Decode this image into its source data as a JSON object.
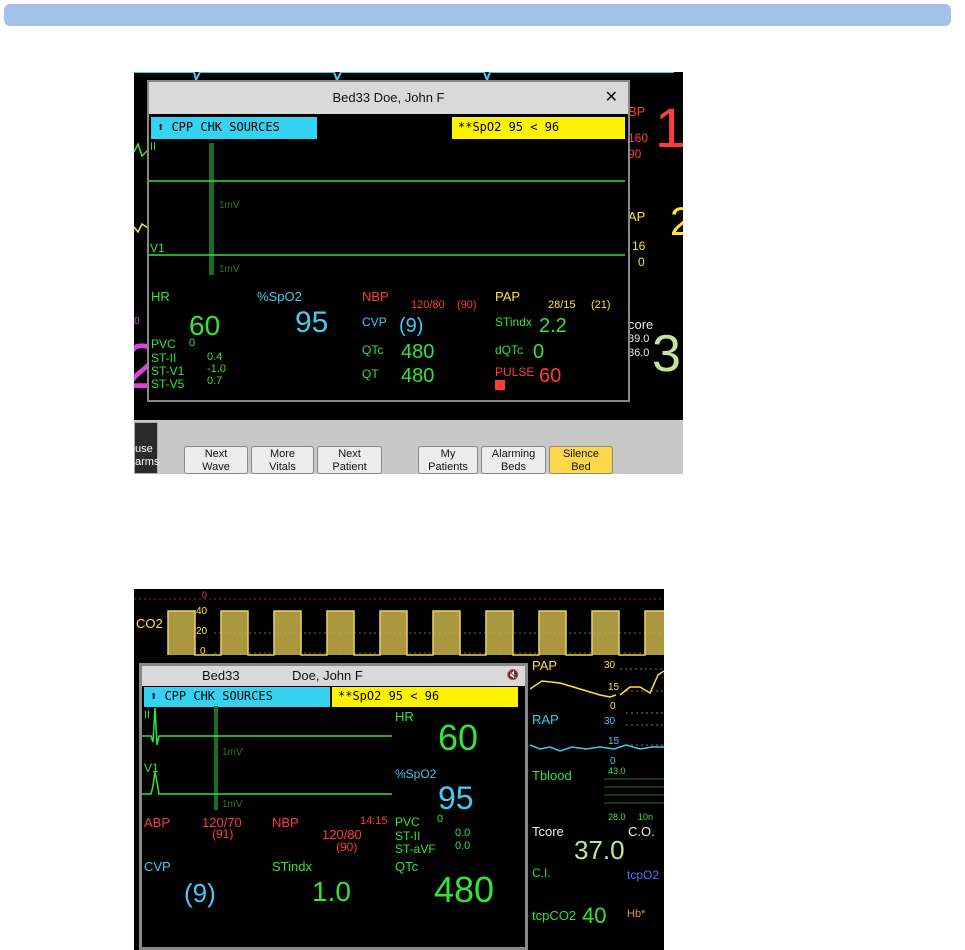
{
  "screen1": {
    "title": "Bed33 Doe, John F",
    "close_glyph": "✕",
    "alarm_cyan": "⬆ CPP     CHK SOURCES",
    "alarm_yellow": "**SpO2 95 < 96",
    "lead_ii": "II",
    "lead_v1": "V1",
    "cal1": "1mV",
    "cal2": "1mV",
    "bg_right": {
      "bp": "BP",
      "bp_big": "1",
      "sys": "160",
      "dia": "90",
      "ap": "AP",
      "ap_big": "2",
      "ap1": "16",
      "ap2": "0",
      "core": "core",
      "core1": "39.0",
      "core2": "36.0",
      "core_big": "3"
    },
    "bg_left": {
      "big": "2",
      "zero": "0"
    },
    "vitals": {
      "hr_label": "HR",
      "hr": "60",
      "spo2_label": "%SpO2",
      "spo2": "95",
      "nbp_label": "NBP",
      "nbp": "120/80",
      "nbp_mean": "(90)",
      "pap_label": "PAP",
      "pap": "28/15",
      "pap_mean": "(21)",
      "cvp_label": "CVP",
      "cvp": "(9)",
      "stindx_label": "STindx",
      "stindx": "2.2",
      "qtc_label": "QTc",
      "qtc": "480",
      "dqtc_label": "dQTc",
      "dqtc": "0",
      "qt_label": "QT",
      "qt": "480",
      "pulse_label": "PULSE",
      "pulse": "60",
      "pvc_label": "PVC",
      "pvc": "0",
      "st2_label": "ST-II",
      "st2": "0.4",
      "stv1_label": "ST-V1",
      "stv1": "-1.0",
      "stv5_label": "ST-V5",
      "stv5": "0.7"
    },
    "pause_alarms": [
      "use",
      "arms"
    ],
    "softkeys": [
      {
        "l1": "Next",
        "l2": "Wave"
      },
      {
        "l1": "More",
        "l2": "Vitals"
      },
      {
        "l1": "Next",
        "l2": "Patient"
      },
      {
        "l1": "My",
        "l2": "Patients"
      },
      {
        "l1": "Alarming",
        "l2": "Beds"
      },
      {
        "l1": "Silence",
        "l2": "Bed"
      }
    ]
  },
  "screen2": {
    "co2_label": "CO2",
    "co2_scale": [
      "0",
      "40",
      "20",
      "0"
    ],
    "title_bed": "Bed33",
    "title_name": "Doe, John F",
    "mute_glyph": "🔇",
    "alarm_cyan": "⬆ CPP     CHK SOURCES",
    "alarm_yellow": "**SpO2 95 < 96",
    "lead_ii": "II",
    "lead_v1": "V1",
    "cal1": "1mV",
    "cal2": "1mV",
    "hr_label": "HR",
    "hr": "60",
    "spo2_label": "%SpO2",
    "spo2": "95",
    "abp_label": "ABP",
    "abp": "120/70",
    "abp_mean": "(91)",
    "nbp_label": "NBP",
    "nbp_time": "14:15",
    "nbp": "120/80",
    "nbp_mean": "(90)",
    "pvc_label": "PVC",
    "pvc": "0",
    "st2_label": "ST-II",
    "st2": "0.0",
    "stavf_label": "ST-aVF",
    "stavf": "0.0",
    "cvp_label": "CVP",
    "cvp": "(9)",
    "stindx_label": "STindx",
    "stindx": "1.0",
    "qtc_label": "QTc",
    "qtc": "480",
    "right": {
      "pap": "PAP",
      "pap30": "30",
      "pap15": "15",
      "pap0": "0",
      "rap": "RAP",
      "rap30": "30",
      "rap15": "15",
      "rap0": "0",
      "tblood": "Tblood",
      "tb43": "43.0",
      "tb28": "28.0",
      "tb10": "10n",
      "tcore": "Tcore",
      "tcore_val": "37.0",
      "co": "C.O.",
      "ci": "C.I.",
      "tcpo2": "tcpO2",
      "tcpco2": "tcpCO2",
      "tcpco2_val": "40",
      "hb": "Hb*"
    }
  },
  "colors": {
    "ecg": "#34e33a",
    "cyan": "#47c8f2",
    "yellow": "#ffe23a",
    "red": "#ff3c3c",
    "co2": "#c8b24a"
  }
}
